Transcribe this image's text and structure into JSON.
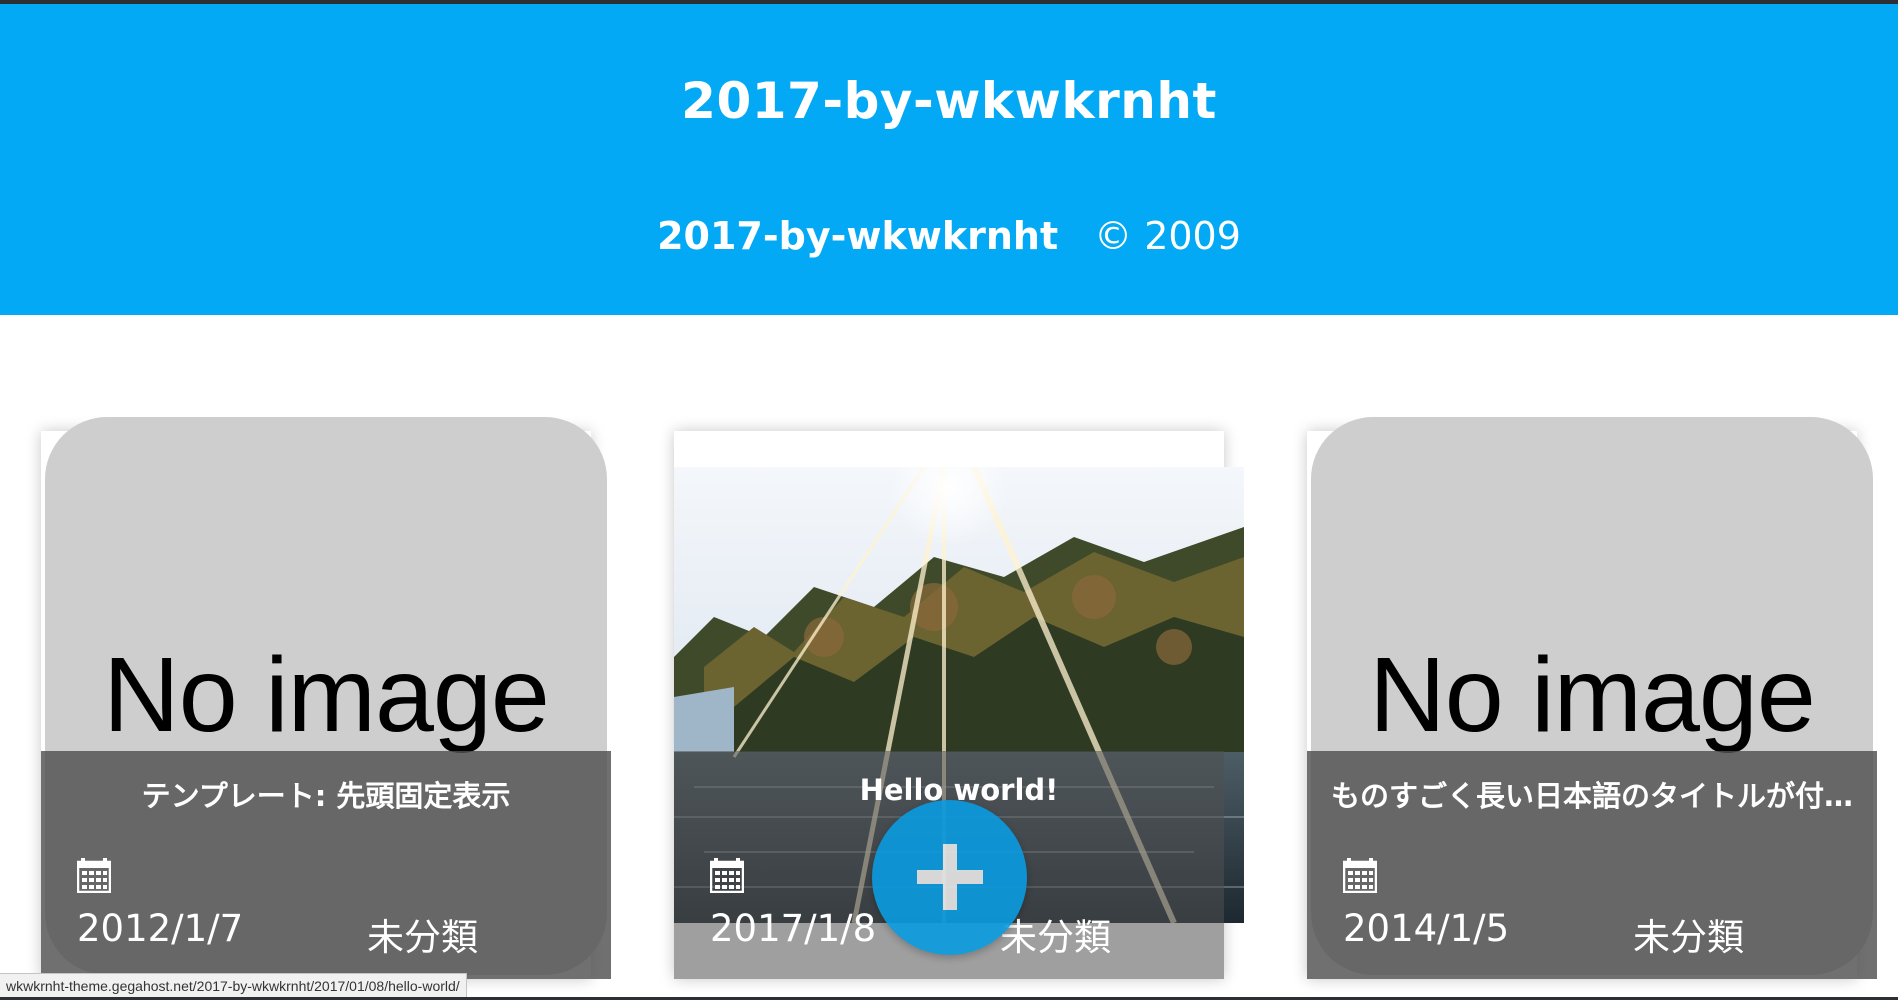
{
  "header": {
    "title": "2017-by-wkwkrnht",
    "footer_name": "2017-by-wkwkrnht",
    "footer_copyright": "© 2009",
    "background_color": "#03a9f4"
  },
  "posts": [
    {
      "title": "テンプレート: 先頭固定表示",
      "date": "2012/1/7",
      "category": "未分類",
      "image_text": "No image",
      "thumbnail": "placeholder"
    },
    {
      "title": "Hello world!",
      "date": "2017/1/8",
      "category": "未分類",
      "thumbnail": "photo-sunlit-trees-lake"
    },
    {
      "title": "ものすごく長い日本語のタイトルが付…",
      "date": "2014/1/5",
      "category": "未分類",
      "image_text": "No image",
      "thumbnail": "placeholder"
    }
  ],
  "fab": {
    "icon": "plus-icon",
    "color": "#0a9be0"
  },
  "status_bar": {
    "url": "wkwkrnht-theme.gegahost.net/2017-by-wkwkrnht/2017/01/08/hello-world/"
  }
}
